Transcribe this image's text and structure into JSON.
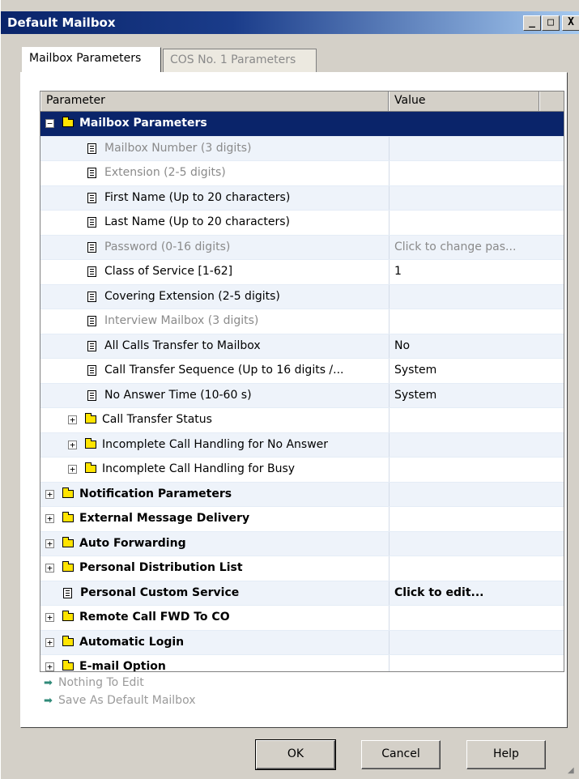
{
  "window": {
    "title": "Default Mailbox",
    "controls": {
      "minimize": "_",
      "maximize": "□",
      "close": "X"
    }
  },
  "tabs": [
    {
      "label": "Mailbox Parameters",
      "active": true
    },
    {
      "label": "COS No. 1 Parameters",
      "active": false
    }
  ],
  "grid": {
    "columns": {
      "parameter": "Parameter",
      "value": "Value"
    },
    "rows": [
      {
        "label": "Mailbox Parameters",
        "value": "",
        "level": 0,
        "kind": "folder",
        "expander": "−",
        "bold": true,
        "gray": false,
        "selected": true
      },
      {
        "label": "Mailbox Number (3 digits)",
        "value": "",
        "level": 1,
        "kind": "doc",
        "gray": true,
        "shade": true
      },
      {
        "label": "Extension (2-5 digits)",
        "value": "",
        "level": 1,
        "kind": "doc",
        "gray": true
      },
      {
        "label": "First Name (Up to 20 characters)",
        "value": "",
        "level": 1,
        "kind": "doc",
        "shade": true
      },
      {
        "label": "Last Name (Up to 20 characters)",
        "value": "",
        "level": 1,
        "kind": "doc"
      },
      {
        "label": "Password (0-16 digits)",
        "value": "Click to change pas...",
        "level": 1,
        "kind": "doc",
        "gray": true,
        "value_gray": true,
        "shade": true
      },
      {
        "label": "Class of Service [1-62]",
        "value": "1",
        "level": 1,
        "kind": "doc"
      },
      {
        "label": "Covering Extension (2-5 digits)",
        "value": "",
        "level": 1,
        "kind": "doc",
        "shade": true
      },
      {
        "label": "Interview Mailbox (3 digits)",
        "value": "",
        "level": 1,
        "kind": "doc",
        "gray": true
      },
      {
        "label": "All Calls Transfer to Mailbox",
        "value": "No",
        "level": 1,
        "kind": "doc",
        "shade": true
      },
      {
        "label": "Call Transfer Sequence (Up to 16 digits /...",
        "value": "System",
        "level": 1,
        "kind": "doc"
      },
      {
        "label": "No Answer Time (10-60 s)",
        "value": "System",
        "level": 1,
        "kind": "doc",
        "shade": true
      },
      {
        "label": "Call Transfer Status",
        "value": "",
        "level": 1,
        "kind": "folder",
        "expander": "+"
      },
      {
        "label": "Incomplete Call Handling for No Answer",
        "value": "",
        "level": 1,
        "kind": "folder",
        "expander": "+",
        "shade": true
      },
      {
        "label": "Incomplete Call Handling for Busy",
        "value": "",
        "level": 1,
        "kind": "folder",
        "expander": "+"
      },
      {
        "label": "Notification Parameters",
        "value": "",
        "level": 0,
        "kind": "folder",
        "expander": "+",
        "bold": true,
        "shade": true
      },
      {
        "label": "External Message Delivery",
        "value": "",
        "level": 0,
        "kind": "folder",
        "expander": "+",
        "bold": true
      },
      {
        "label": "Auto Forwarding",
        "value": "",
        "level": 0,
        "kind": "folder",
        "expander": "+",
        "bold": true,
        "shade": true
      },
      {
        "label": "Personal Distribution List",
        "value": "",
        "level": 0,
        "kind": "folder",
        "expander": "+",
        "bold": true
      },
      {
        "label": "Personal Custom Service",
        "value": "Click to edit...",
        "level": 0,
        "kind": "doc",
        "bold": true,
        "value_bold": true,
        "shade": true
      },
      {
        "label": "Remote Call FWD To CO",
        "value": "",
        "level": 0,
        "kind": "folder",
        "expander": "+",
        "bold": true
      },
      {
        "label": "Automatic Login",
        "value": "",
        "level": 0,
        "kind": "folder",
        "expander": "+",
        "bold": true,
        "shade": true
      },
      {
        "label": "E-mail Option",
        "value": "",
        "level": 0,
        "kind": "folder",
        "expander": "+",
        "bold": true
      }
    ]
  },
  "actions": [
    {
      "label": "Nothing To Edit",
      "icon": "arrow-right-icon"
    },
    {
      "label": "Save As Default Mailbox",
      "icon": "arrow-right-icon"
    }
  ],
  "buttons": {
    "ok": "OK",
    "cancel": "Cancel",
    "help": "Help"
  },
  "colors": {
    "selection": "#0a246a",
    "folder": "#ffe400",
    "action_arrow": "#2f8a78"
  }
}
